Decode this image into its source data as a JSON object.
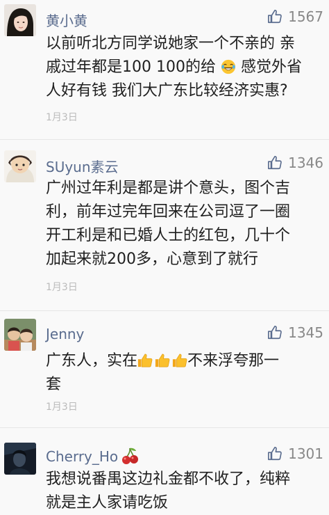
{
  "comments": [
    {
      "author": "黄小黄",
      "likes": "1567",
      "lines": [
        "以前听北方同学说她家一个不亲的 亲",
        "戚过年都是100 100的给",
        "人好有钱 我们大广东比较经济实惠?"
      ],
      "line2_tail": "感觉外省",
      "date": "1月3日",
      "avatar_icon": "woman-portrait-icon",
      "inline_emoji": "laughing-tears-emoji"
    },
    {
      "author": "SUyun素云",
      "likes": "1346",
      "lines": [
        "广州过年利是都是讲个意头，图个吉",
        "利，前年过完年回来在公司逗了一圈",
        "开工利是和已婚人士的红包，几十个",
        "加起来就200多，心意到了就行"
      ],
      "date": "1月3日",
      "avatar_icon": "cartoon-boy-icon"
    },
    {
      "author": "Jenny",
      "likes": "1345",
      "line1_head": "广东人，实在",
      "line1_tail": "不来浮夸那一",
      "line2": "套",
      "date": "1月3日",
      "avatar_icon": "two-kids-photo-icon",
      "inline_emoji": "thumbs-up-emoji"
    },
    {
      "author": "Cherry_Ho",
      "likes": "1301",
      "lines": [
        "我想说番禺这边礼金都不收了，纯粹",
        "就是主人家请吃饭"
      ],
      "avatar_icon": "dark-portrait-icon",
      "name_emoji": "cherry-emoji"
    }
  ],
  "colors": {
    "author": "#5a6c8e",
    "like": "#888888",
    "date": "#bbbbbb",
    "body": "#1f1f1f",
    "background": "#f9f9f9",
    "thumb_icon": "#5a6c8e"
  },
  "icons": {
    "like": "thumbs-up-outline-icon"
  }
}
